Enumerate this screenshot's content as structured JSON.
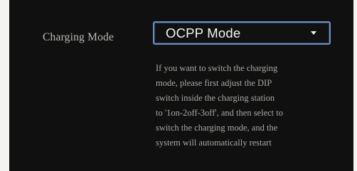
{
  "settings": {
    "charging_mode": {
      "label": "Charging Mode",
      "selected": "OCPP Mode",
      "icon": "chevron-down-icon",
      "help_lines": [
        "If you want to switch the charging",
        "mode, please first adjust the DIP",
        "switch inside the charging station",
        "to '1on-2off-3off', and then select to",
        "switch the charging mode, and the",
        "system will automatically restart"
      ]
    }
  },
  "colors": {
    "panel_background": "#101010",
    "page_background": "#f3f3f1",
    "select_border": "#6f8dbf",
    "label_text": "#b9b9b5",
    "help_text": "#a7a7a3"
  }
}
